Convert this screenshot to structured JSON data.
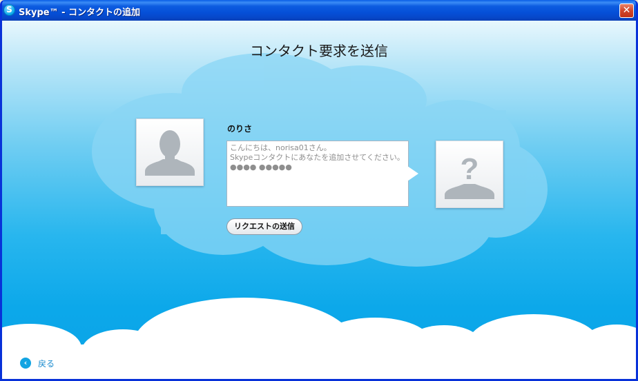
{
  "window": {
    "title": "Skype™ - コンタクトの追加",
    "app_icon_glyph": "S",
    "close_glyph": "✕"
  },
  "heading": "コンタクト要求を送信",
  "contact": {
    "name": "のりさ"
  },
  "message": {
    "text": "こんにちは、norisa01さん。\nSkypeコンタクトにあなたを追加させてください。\n●●●● ●●●●●"
  },
  "actions": {
    "send_request": "リクエストの送信",
    "back": "戻る",
    "back_glyph": "‹"
  },
  "colors": {
    "titlebar": "#0550d8",
    "sky_top": "#e8f7fd",
    "sky_bottom": "#0aa3e6",
    "cloud": "#7fd3f4",
    "link": "#1c8ccf"
  },
  "icons": {
    "my_avatar": "default-person-icon",
    "contact_avatar": "unknown-person-icon",
    "back": "back-arrow-icon"
  }
}
